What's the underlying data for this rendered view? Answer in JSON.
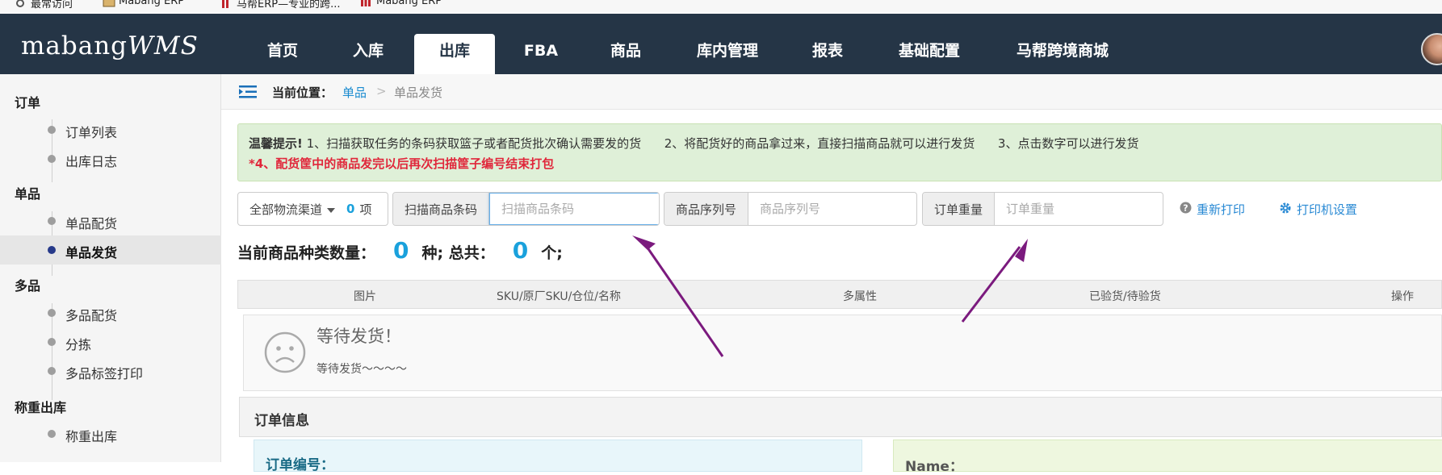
{
  "bookmarks": [
    {
      "label": "最常访问",
      "icon": "gear-icon"
    },
    {
      "label": "Mabang ERP",
      "icon": "bookmark-image-icon"
    },
    {
      "label": "马帮ERP—专业的跨...",
      "icon": "mabang-logo-icon"
    },
    {
      "label": "Mabang ERP",
      "icon": "mabang-logo-icon"
    }
  ],
  "header": {
    "logo_main": "mabang",
    "logo_suffix": "WMS",
    "nav": [
      "首页",
      "入库",
      "出库",
      "FBA",
      "商品",
      "库内管理",
      "报表",
      "基础配置",
      "马帮跨境商城"
    ],
    "active_nav": "出库"
  },
  "sidebar": {
    "groups": [
      {
        "title": "订单",
        "items": [
          "订单列表",
          "出库日志"
        ]
      },
      {
        "title": "单品",
        "items": [
          "单品配货",
          "单品发货"
        ]
      },
      {
        "title": "多品",
        "items": [
          "多品配货",
          "分拣",
          "多品标签打印"
        ]
      },
      {
        "title": "称重出库",
        "items": [
          "称重出库"
        ]
      }
    ],
    "active_item": "单品发货"
  },
  "breadcrumb": {
    "prefix": "当前位置：",
    "level1": "单品",
    "separator": ">",
    "current": "单品发货"
  },
  "tip": {
    "title": "温馨提示!",
    "line1": " 1、扫描获取任务的条码获取篮子或者配货批次确认需要发的货      2、将配货好的商品拿过来，直接扫描商品就可以进行发货      3、点击数字可以进行发货",
    "line2": "*4、配货筐中的商品发完以后再次扫描筐子编号结束打包"
  },
  "toolbar": {
    "channel_select": "全部物流渠道",
    "channel_count": "0",
    "channel_count_unit": "项",
    "scan_label": "扫描商品条码",
    "scan_placeholder": "扫描商品条码",
    "serial_label": "商品序列号",
    "serial_placeholder": "商品序列号",
    "weight_label": "订单重量",
    "weight_placeholder": "订单重量",
    "reprint": "重新打印",
    "printer_settings": "打印机设置"
  },
  "summary": {
    "kinds_label": "当前商品种类数量：",
    "kinds_value": "0",
    "total_label": "种; 总共：",
    "total_value": "0",
    "unit": "个;"
  },
  "table": {
    "columns": [
      "图片",
      "SKU/原厂SKU/仓位/名称",
      "多属性",
      "已验货/待验货",
      "操作"
    ]
  },
  "empty_state": {
    "title": "等待发货！",
    "subtitle": "等待发货～～～～"
  },
  "order_info": {
    "title": "订单信息",
    "left_label": "订单编号：",
    "right_label": "Name："
  },
  "colors": {
    "nav_bg": "#253546",
    "accent": "#1aa1dc",
    "tip_bg": "#dff0d8",
    "warning": "#e0273b",
    "annotation_arrow": "#7b1a7e"
  }
}
